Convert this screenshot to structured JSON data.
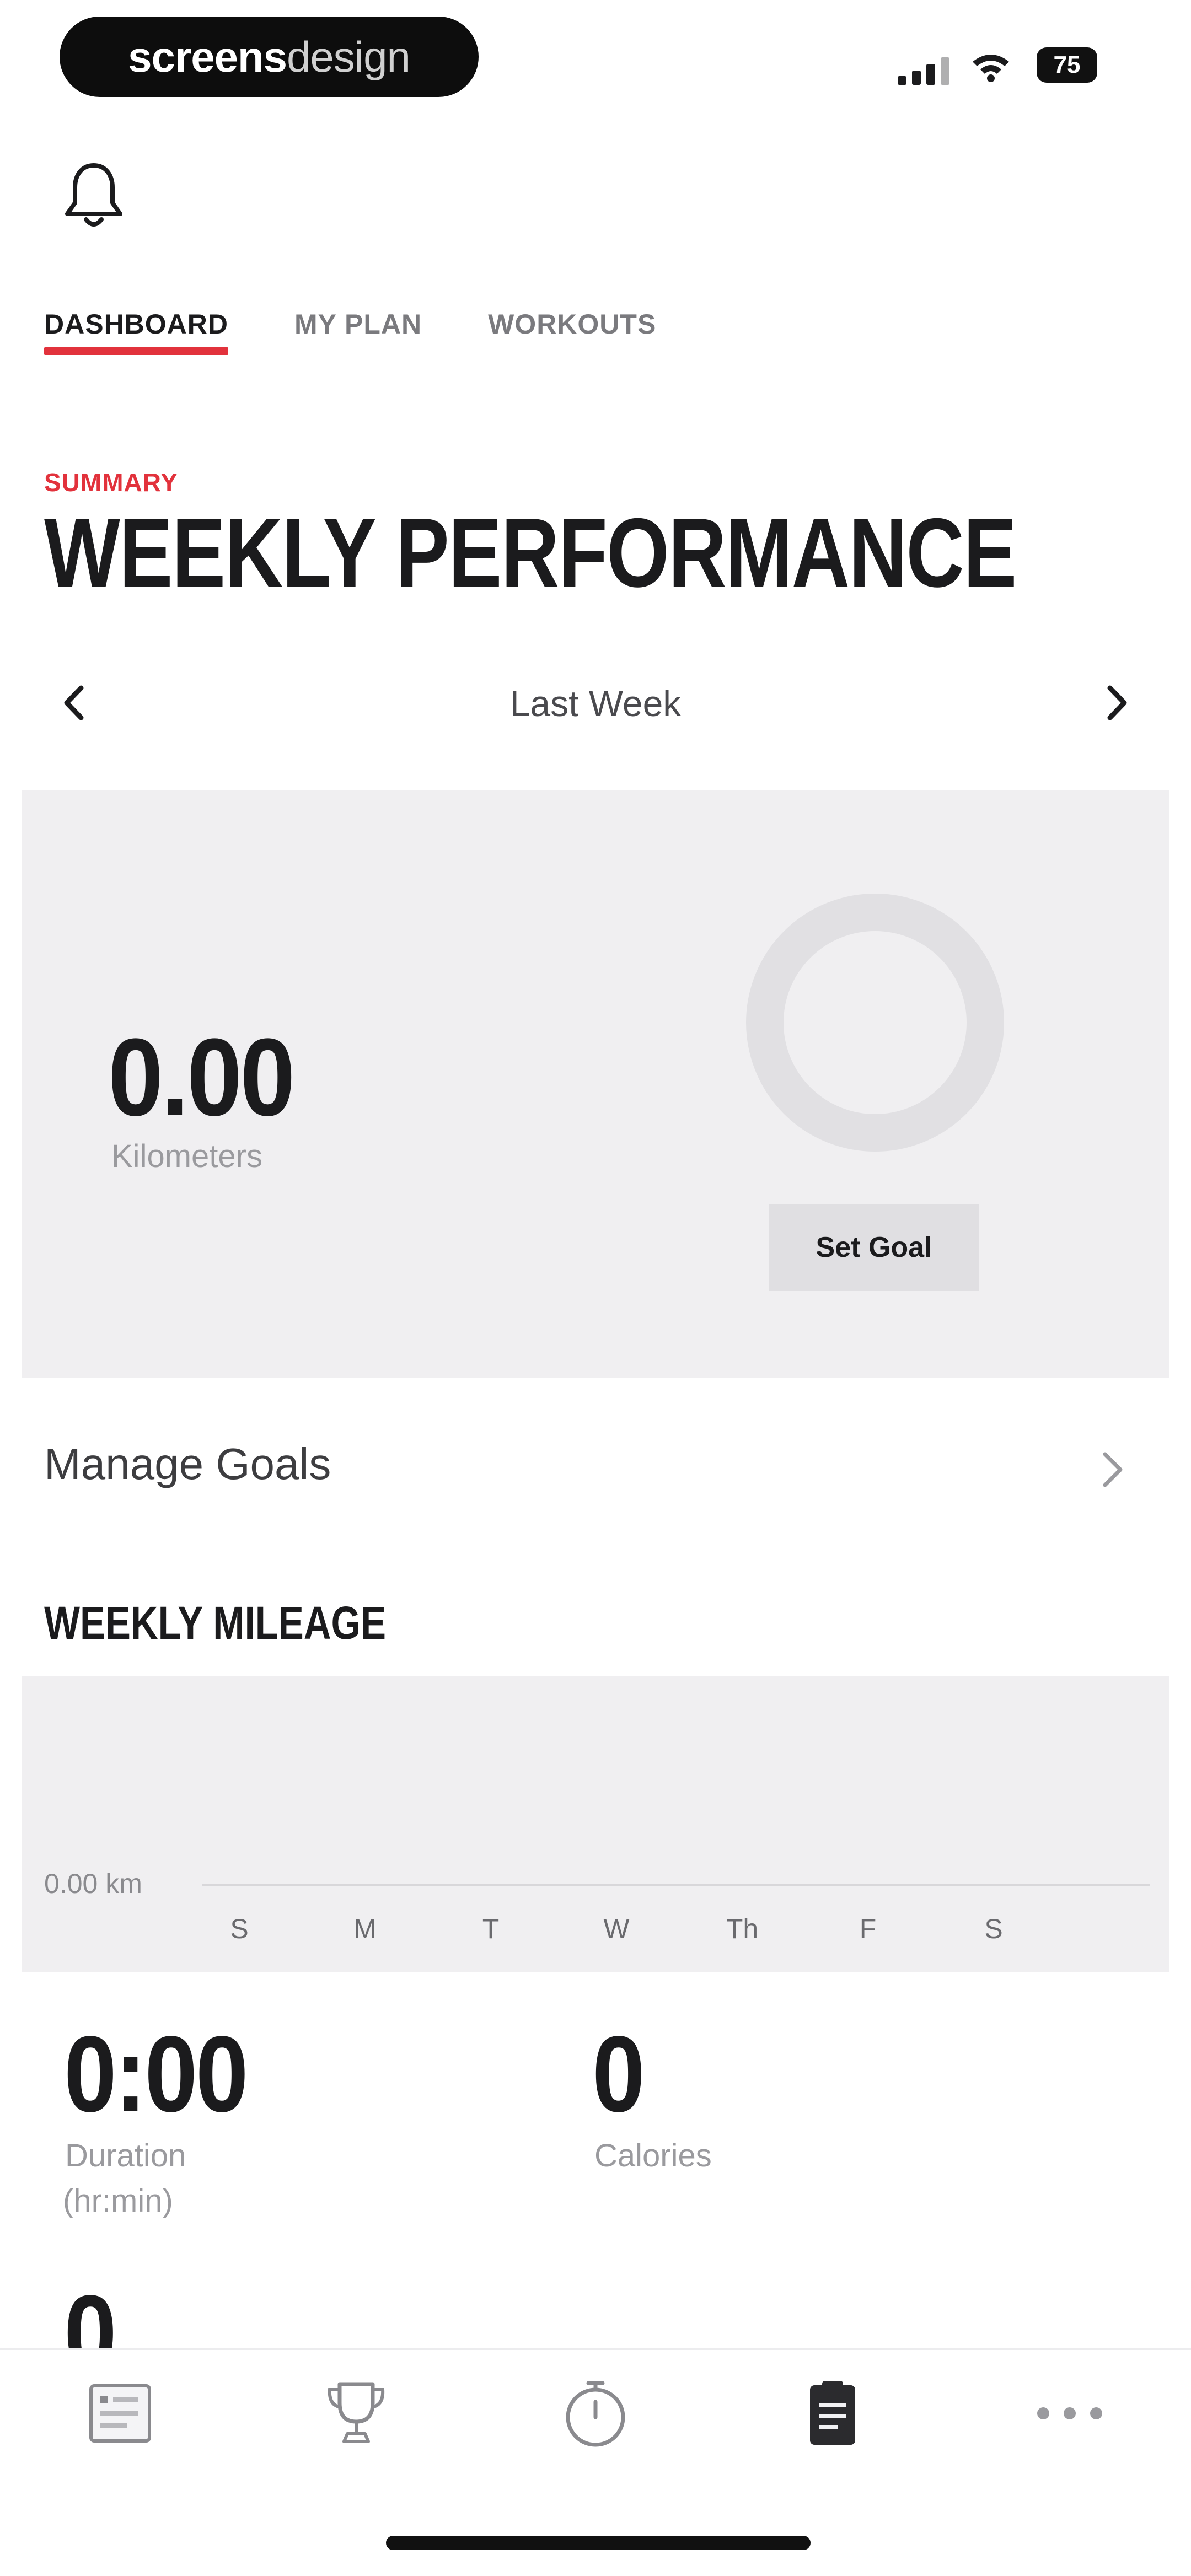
{
  "status_bar": {
    "brand_bold": "screens",
    "brand_light": "design",
    "battery_level": "75"
  },
  "icons": {
    "notifications": "bell-icon",
    "prev_week": "chevron-left-icon",
    "next_week": "chevron-right-icon",
    "manage_goals": "chevron-right-icon",
    "tabbar": [
      "log-icon",
      "trophy-icon",
      "stopwatch-icon",
      "plan-icon",
      "more-icon"
    ]
  },
  "tabs": [
    {
      "label": "DASHBOARD",
      "active": true
    },
    {
      "label": "MY PLAN",
      "active": false
    },
    {
      "label": "WORKOUTS",
      "active": false
    }
  ],
  "summary": {
    "eyebrow": "SUMMARY",
    "title": "WEEKLY PERFORMANCE",
    "week_label": "Last Week",
    "distance_value": "0.00",
    "distance_unit": "Kilometers",
    "goal_progress": 0,
    "set_goal_label": "Set Goal"
  },
  "manage_goals": {
    "label": "Manage Goals"
  },
  "weekly_mileage": {
    "title": "WEEKLY MILEAGE",
    "axis_label": "0.00 km",
    "days": [
      "S",
      "M",
      "T",
      "W",
      "Th",
      "F",
      "S"
    ]
  },
  "stats": {
    "duration_value": "0:00",
    "duration_label": "Duration",
    "duration_sub": "(hr:min)",
    "calories_value": "0",
    "calories_label": "Calories",
    "third_value": "0"
  },
  "colors": {
    "accent": "#e2323c",
    "card_bg": "#f0eff1",
    "text": "#1b1b1d",
    "muted": "#9a9a9e"
  }
}
